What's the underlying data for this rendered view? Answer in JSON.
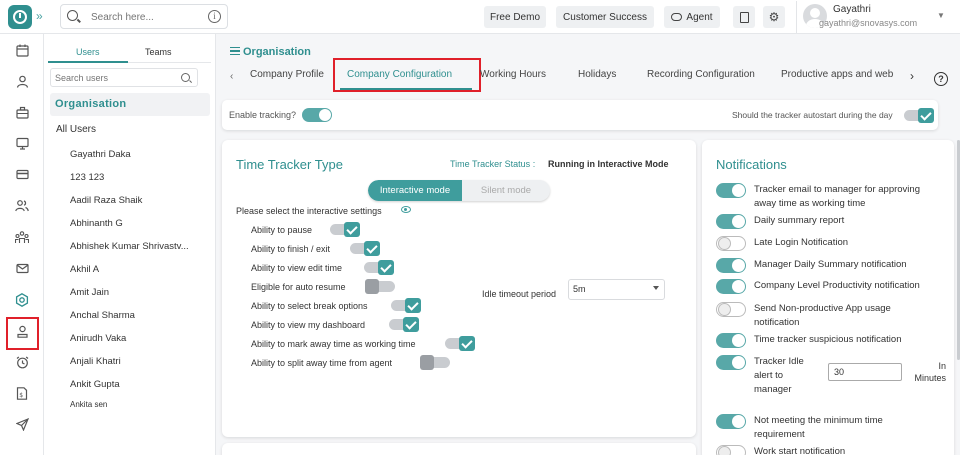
{
  "topbar": {
    "search_placeholder": "Search here...",
    "free_demo": "Free Demo",
    "customer_success": "Customer Success",
    "agent": "Agent",
    "user_name": "Gayathri",
    "user_email": "gayathri@snovasys.com"
  },
  "rail": {
    "icons": [
      "calendar-icon",
      "user-icon",
      "briefcase-icon",
      "monitor-icon",
      "card-icon",
      "users-icon",
      "team-icon",
      "mail-icon",
      "settings-icon",
      "person-icon",
      "alarm-icon",
      "document-icon",
      "send-icon"
    ]
  },
  "userpanel": {
    "tab_users": "Users",
    "tab_teams": "Teams",
    "search_placeholder": "Search users",
    "org_label": "Organisation",
    "all_users": "All Users",
    "users": [
      "Gayathri Daka",
      "123 123",
      "Aadil Raza Shaik",
      "Abhinanth G",
      "Abhishek Kumar Shrivastv...",
      "Akhil A",
      "Amit Jain",
      "Anchal Sharma",
      "Anirudh Vaka",
      "Anjali Khatri",
      "Ankit Gupta",
      "Ankita sen"
    ]
  },
  "main": {
    "title": "Organisation",
    "tabs": [
      "Company Profile",
      "Company Configuration",
      "Working Hours",
      "Holidays",
      "Recording Configuration",
      "Productive apps and web"
    ],
    "active_tab": "Company Configuration"
  },
  "tracking": {
    "enable_label": "Enable tracking?",
    "enable_on": true,
    "autostart_label": "Should the tracker autostart during the day",
    "autostart_on": true
  },
  "time_tracker": {
    "title": "Time Tracker Type",
    "status_label": "Time Tracker Status :",
    "status_value": "Running in Interactive Mode",
    "mode_interactive": "Interactive mode",
    "mode_silent": "Silent mode",
    "settings_prompt": "Please select the interactive settings",
    "settings": [
      {
        "label": "Ability to pause",
        "on": true
      },
      {
        "label": "Ability to finish / exit",
        "on": true
      },
      {
        "label": "Ability to view edit time",
        "on": true
      },
      {
        "label": "Eligible for auto resume",
        "on": false
      },
      {
        "label": "Ability to select break options",
        "on": true
      },
      {
        "label": "Ability to view my dashboard",
        "on": true
      },
      {
        "label": "Ability to mark away time as working time",
        "on": true
      },
      {
        "label": "Ability to split away time from agent",
        "on": false
      }
    ],
    "idle_timeout_label": "Idle timeout period",
    "idle_timeout_value": "5m"
  },
  "notifications": {
    "title": "Notifications",
    "items": [
      {
        "label": "Tracker email to manager for approving away time as working time",
        "on": true
      },
      {
        "label": "Daily summary report",
        "on": true
      },
      {
        "label": "Late Login Notification",
        "on": false
      },
      {
        "label": "Manager Daily Summary notification",
        "on": true
      },
      {
        "label": "Company Level Productivity notification",
        "on": true
      },
      {
        "label": "Send Non-productive App usage notification",
        "on": false
      },
      {
        "label": "Time tracker suspicious notification",
        "on": true
      },
      {
        "label": "Tracker Idle alert to manager",
        "on": true
      },
      {
        "label": "Not meeting the minimum time requirement",
        "on": true
      },
      {
        "label": "Work start notification",
        "on": false
      }
    ],
    "idle_alert_value": "30",
    "idle_alert_unit": "In Minutes"
  },
  "colors": {
    "brand": "#2f8f8f",
    "toggle_on": "#58a8a8",
    "highlight": "#e0202a"
  }
}
